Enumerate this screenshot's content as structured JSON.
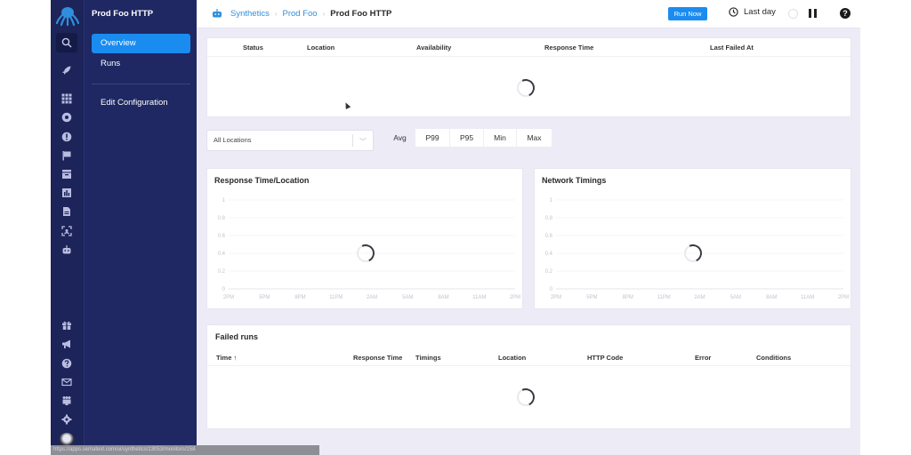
{
  "app": {
    "monitor_title": "Prod Foo HTTP",
    "subnav": {
      "items": [
        {
          "label": "Overview",
          "active": true
        },
        {
          "label": "Runs",
          "active": false
        },
        {
          "label": "Edit Configuration",
          "active": false
        }
      ]
    },
    "rail": {
      "top_icons": [
        "search-icon",
        "rocket-icon"
      ],
      "mid_icons": [
        "apps-grid-icon",
        "dashboard-gauge-icon",
        "alert-icon",
        "flag-icon",
        "inbox-icon",
        "reports-chart-icon",
        "document-icon",
        "scan-icon",
        "synthetics-robot-icon"
      ],
      "bottom_icons": [
        "gift-icon",
        "megaphone-icon",
        "help-circle-icon",
        "mail-icon",
        "team-icon",
        "settings-gear-icon",
        "avatar"
      ]
    }
  },
  "topbar": {
    "breadcrumbs": [
      {
        "label": "Synthetics",
        "link": true
      },
      {
        "label": "Prod Foo",
        "link": true
      },
      {
        "label": "Prod Foo HTTP",
        "link": false
      }
    ],
    "run_now_label": "Run Now",
    "time_range_label": "Last day",
    "accent_color": "#1a8cf0"
  },
  "status_table": {
    "columns": [
      "Status",
      "Location",
      "Availability",
      "Response Time",
      "Last Failed At"
    ],
    "loading": true
  },
  "filters": {
    "location_select": "All Locations",
    "aggregations": [
      "Avg",
      "P99",
      "P95",
      "Min",
      "Max"
    ],
    "selected_aggregation": "Avg"
  },
  "chart_data": [
    {
      "type": "line",
      "title": "Response Time/Location",
      "series": [],
      "x": [
        "2PM",
        "5PM",
        "8PM",
        "11PM",
        "2AM",
        "5AM",
        "8AM",
        "11AM",
        "2PM"
      ],
      "y_ticks": [
        "0",
        "0.2",
        "0.4",
        "0.6",
        "0.8",
        "1"
      ],
      "ylim": [
        0,
        1
      ],
      "grid": true,
      "loading": true,
      "xlabel": "",
      "ylabel": ""
    },
    {
      "type": "line",
      "title": "Network Timings",
      "series": [],
      "x": [
        "2PM",
        "5PM",
        "8PM",
        "11PM",
        "2AM",
        "5AM",
        "8AM",
        "11AM",
        "2PM"
      ],
      "y_ticks": [
        "0",
        "0.2",
        "0.4",
        "0.6",
        "0.8",
        "1"
      ],
      "ylim": [
        0,
        1
      ],
      "grid": true,
      "loading": true,
      "xlabel": "",
      "ylabel": ""
    }
  ],
  "failed_runs": {
    "title": "Failed runs",
    "columns": [
      "Time",
      "Response Time",
      "Timings",
      "Location",
      "HTTP Code",
      "Error",
      "Conditions"
    ],
    "sort_indicator": "↑",
    "loading": true
  },
  "browser_status_url": "https://apps.sematext.com/ui/synthetics/13053/monitors/158"
}
